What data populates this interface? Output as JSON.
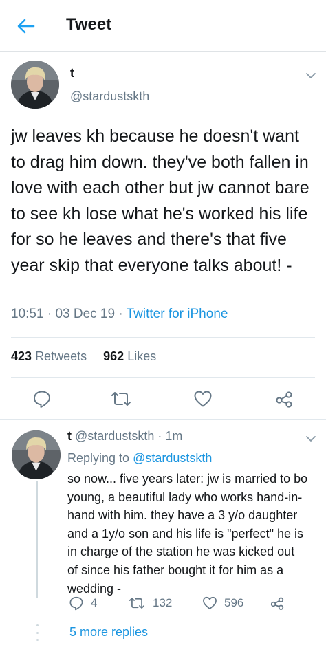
{
  "header": {
    "title": "Tweet"
  },
  "tweet": {
    "name": "t",
    "handle": "@stardustskth",
    "text": "jw leaves kh because he doesn't want to drag him down. they've both fallen in love with each other but jw cannot bare to see kh lose what he's worked his life for so he leaves and there's that five year skip that everyone talks about! -",
    "time": "10:51",
    "date": "03 Dec 19",
    "source": "Twitter for iPhone",
    "retweets_count": "423",
    "retweets_label": "Retweets",
    "likes_count": "962",
    "likes_label": "Likes"
  },
  "reply": {
    "name": "t",
    "handle": "@stardustskth",
    "age": "1m",
    "replying_prefix": "Replying to",
    "replying_to": "@stardustskth",
    "text": "so now... five years later: jw is married to bo young, a beautiful lady who works hand-in-hand with him. they have a 3 y/o daughter and a 1y/o son and his life is \"perfect\" he is in charge of the station he was kicked out of since his father bought it for him as a wedding -",
    "reply_count": "4",
    "retweet_count": "132",
    "like_count": "596"
  },
  "thread": {
    "more_replies": "5 more replies"
  },
  "icons": {
    "back": "arrow-left-icon",
    "caret": "chevron-down-icon",
    "reply": "speech-bubble-icon",
    "retweet": "retweet-arrows-icon",
    "like": "heart-icon",
    "share": "share-nodes-icon"
  },
  "colors": {
    "accent": "#1b95e0",
    "text": "#14171a",
    "secondary": "#657786",
    "divider": "#e1e8ed"
  }
}
